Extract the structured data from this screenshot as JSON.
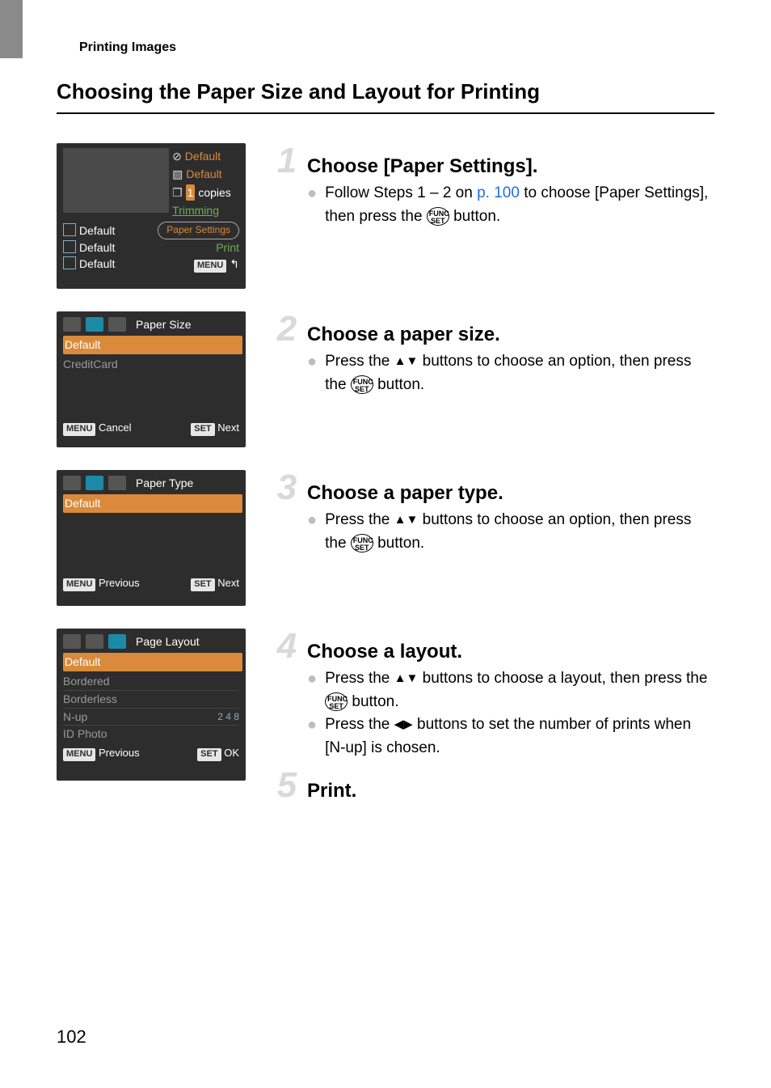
{
  "page": {
    "running_head": "Printing Images",
    "section_title": "Choosing the Paper Size and Layout for Printing",
    "page_number": "102"
  },
  "screens": {
    "print_settings": {
      "right_col": [
        "Default",
        "Default",
        "copies",
        "Trimming"
      ],
      "copies_value": "1",
      "left_col": [
        "Default",
        "Default",
        "Default"
      ],
      "paper_settings_pill": "Paper Settings",
      "print_label": "Print",
      "menu_label": "MENU"
    },
    "paper_size": {
      "title": "Paper Size",
      "items": [
        "Default",
        "CreditCard"
      ],
      "cancel_label": "Cancel",
      "next_label": "Next",
      "menu_btn": "MENU",
      "set_btn": "SET"
    },
    "paper_type": {
      "title": "Paper Type",
      "items": [
        "Default"
      ],
      "prev_label": "Previous",
      "next_label": "Next",
      "menu_btn": "MENU",
      "set_btn": "SET"
    },
    "page_layout": {
      "title": "Page Layout",
      "items": [
        "Default",
        "Bordered",
        "Borderless",
        "N-up",
        "ID Photo"
      ],
      "nup_values": "2 4 8",
      "prev_label": "Previous",
      "ok_label": "OK",
      "menu_btn": "MENU",
      "set_btn": "SET"
    }
  },
  "steps": {
    "s1": {
      "num": "1",
      "title": "Choose [Paper Settings].",
      "bullet1_pre": "Follow Steps 1 – 2 on ",
      "bullet1_link": "p. 100",
      "bullet1_post": " to choose [Paper Settings], then press the ",
      "bullet1_end": " button."
    },
    "s2": {
      "num": "2",
      "title": "Choose a paper size.",
      "bullet1_pre": "Press the ",
      "bullet1_mid": " buttons to choose an option, then press the ",
      "bullet1_end": " button."
    },
    "s3": {
      "num": "3",
      "title": "Choose a paper type.",
      "bullet1_pre": "Press the ",
      "bullet1_mid": " buttons to choose an option, then press the ",
      "bullet1_end": " button."
    },
    "s4": {
      "num": "4",
      "title": "Choose a layout.",
      "bullet1_pre": "Press the ",
      "bullet1_mid": " buttons to choose a layout, then press the ",
      "bullet1_end": " button.",
      "bullet2_pre": "Press the ",
      "bullet2_post": " buttons to set the number of prints when [N-up] is chosen."
    },
    "s5": {
      "num": "5",
      "title": "Print."
    }
  }
}
